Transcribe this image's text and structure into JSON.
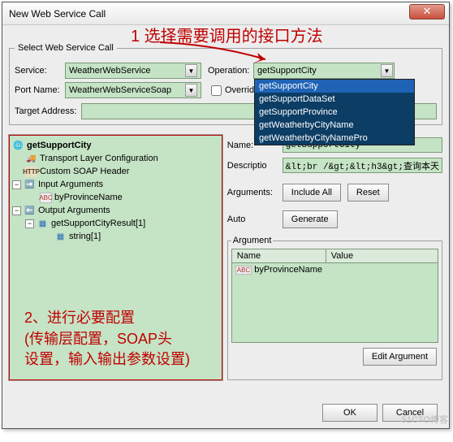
{
  "window": {
    "title": "New Web Service Call"
  },
  "annotations": {
    "step1": "1  选择需要调用的接口方法",
    "step2_line1": "2、进行必要配置",
    "step2_line2": "(传输层配置，SOAP头",
    "step2_line3": "设置，输入输出参数设置)"
  },
  "group": {
    "legend": "Select Web Service Call",
    "service_label": "Service:",
    "service_value": "WeatherWebService",
    "portname_label": "Port Name:",
    "portname_value": "WeatherWebServiceSoap",
    "operation_label": "Operation:",
    "operation_value": "getSupportCity",
    "override_label": "Overrid",
    "target_label": "Target Address:",
    "dropdown": [
      "getSupportCity",
      "getSupportDataSet",
      "getSupportProvince",
      "getWeatherbyCityName",
      "getWeatherbyCityNamePro"
    ]
  },
  "tree": {
    "root": "getSupportCity",
    "transport": "Transport Layer Configuration",
    "soap": "Custom SOAP Header",
    "in_args": "Input Arguments",
    "in_param": "byProvinceName",
    "out_args": "Output Arguments",
    "out_result": "getSupportCityResult[1]",
    "out_string": "string[1]"
  },
  "props": {
    "name_label": "Name:",
    "name_value": "getSupportCity",
    "desc_label": "Descriptio",
    "desc_value": "&lt;br /&gt;&lt;h3&gt;查询本天",
    "arguments_label": "Arguments:",
    "include_all": "Include All",
    "reset": "Reset",
    "auto_label": "Auto",
    "generate": "Generate"
  },
  "arg_group": {
    "legend": "Argument",
    "col_name": "Name",
    "col_value": "Value",
    "row1_name": "byProvinceName",
    "edit_btn": "Edit Argument"
  },
  "buttons": {
    "ok": "OK",
    "cancel": "Cancel"
  },
  "watermark": "51CTO博客"
}
